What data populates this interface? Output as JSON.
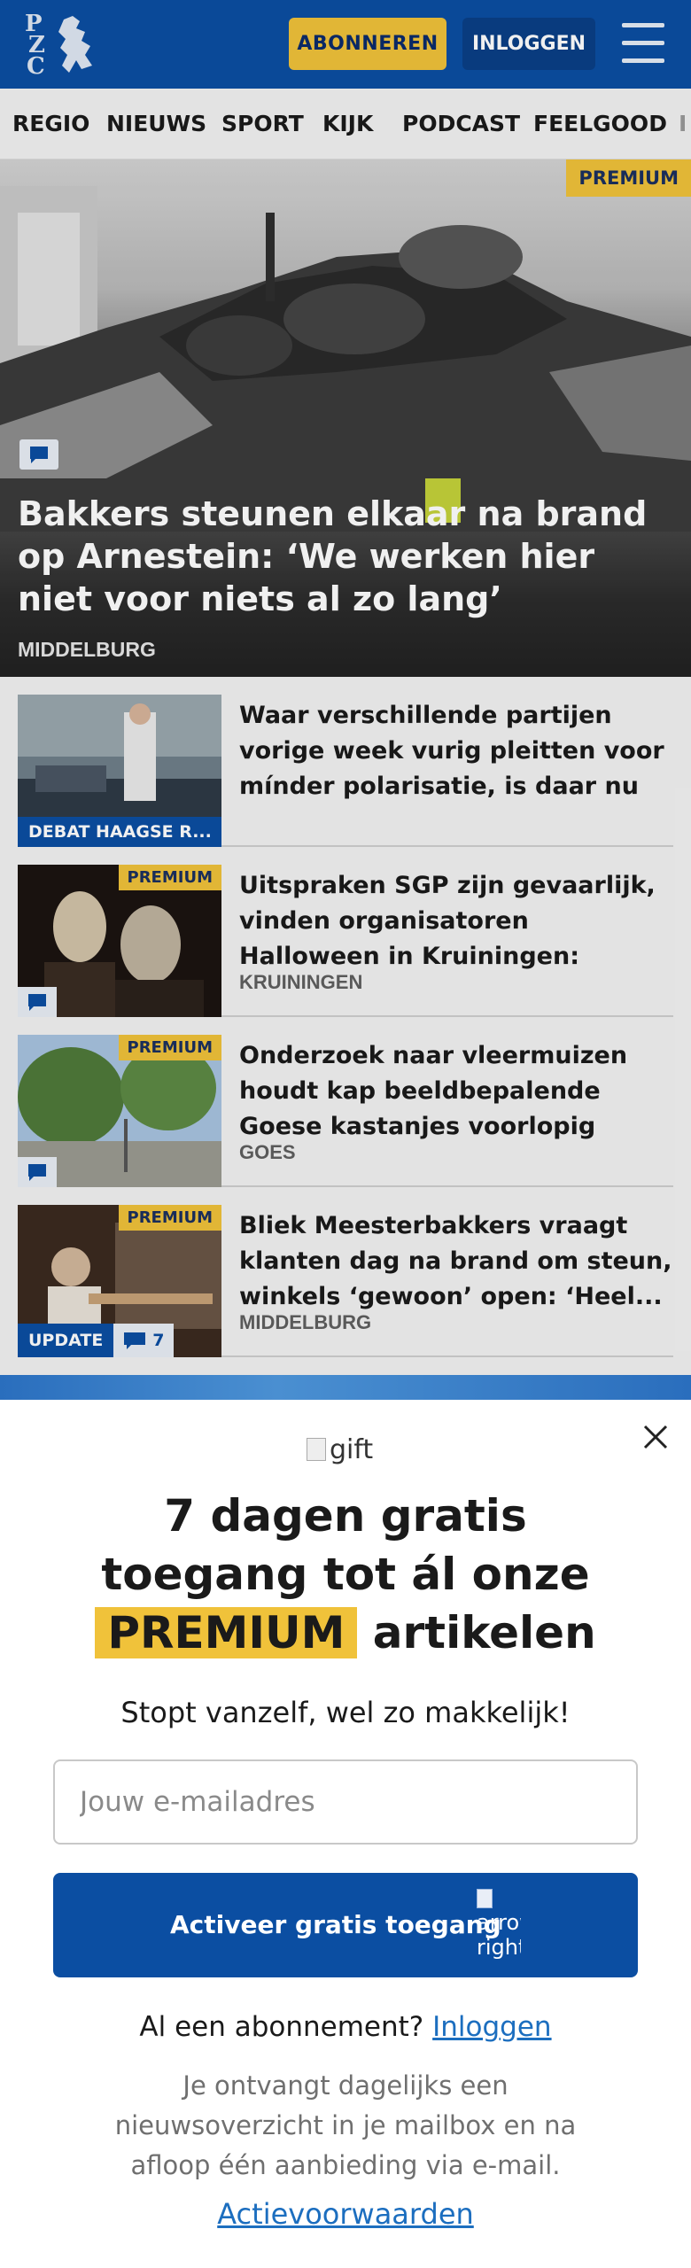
{
  "header": {
    "logo_letters": [
      "P",
      "Z",
      "C"
    ],
    "subscribe_label": "ABONNEREN",
    "login_label": "INLOGGEN",
    "menu_icon": "hamburger-icon"
  },
  "nav": {
    "items": [
      "REGIO",
      "NIEUWS",
      "SPORT",
      "KIJK",
      "PODCAST",
      "FEELGOOD",
      "I"
    ]
  },
  "hero": {
    "badge": "PREMIUM",
    "title": "Bakkers steunen elkaar na brand op Arnestein: ‘We werken hier niet voor niets al zo lang’",
    "location": "MIDDELBURG",
    "comment_icon": "comment-icon"
  },
  "articles": [
    {
      "headline": "Waar verschillende partijen vorige week vurig pleitten voor mínder polarisatie, is daar nu al...",
      "category": "DEBAT HAAGSE R...",
      "location": ""
    },
    {
      "headline": "Uitspraken SGP zijn gevaarlijk, vinden organisatoren Halloween in Kruiningen: 'Auto's rijden...",
      "badge": "PREMIUM",
      "location": "KRUININGEN"
    },
    {
      "headline": "Onderzoek naar vleermuizen houdt kap beeldbepalende Goese kastanjes voorlopig tegen",
      "badge": "PREMIUM",
      "location": "GOES"
    },
    {
      "headline": "Bliek Meesterbakkers vraagt klanten dag na brand om steun, winkels ‘gewoon’ open: ‘Heel...",
      "badge": "PREMIUM",
      "update_label": "UPDATE",
      "comment_count": "7",
      "location": "MIDDELBURG"
    }
  ],
  "modal": {
    "gift_alt": "gift",
    "title_line1": "7 dagen gratis",
    "title_line2": "toegang tot ál onze",
    "title_highlight": "PREMIUM",
    "title_line3_rest": "artikelen",
    "subtitle": "Stopt vanzelf, wel zo makkelijk!",
    "email_placeholder": "Jouw e-mailadres",
    "cta_label": "Activeer gratis toegang",
    "cta_arrow_alt": "arrow-right",
    "already_text": "Al een abonnement?",
    "already_link": "Inloggen",
    "info": "Je ontvangt dagelijks een nieuwsoverzicht in je mailbox en na afloop één aanbieding via e-mail.",
    "terms": "Actievoorwaarden"
  },
  "colors": {
    "brand_blue": "#0b4ea2",
    "premium_yellow": "#f0c23a",
    "link_blue": "#1c6ebf"
  }
}
